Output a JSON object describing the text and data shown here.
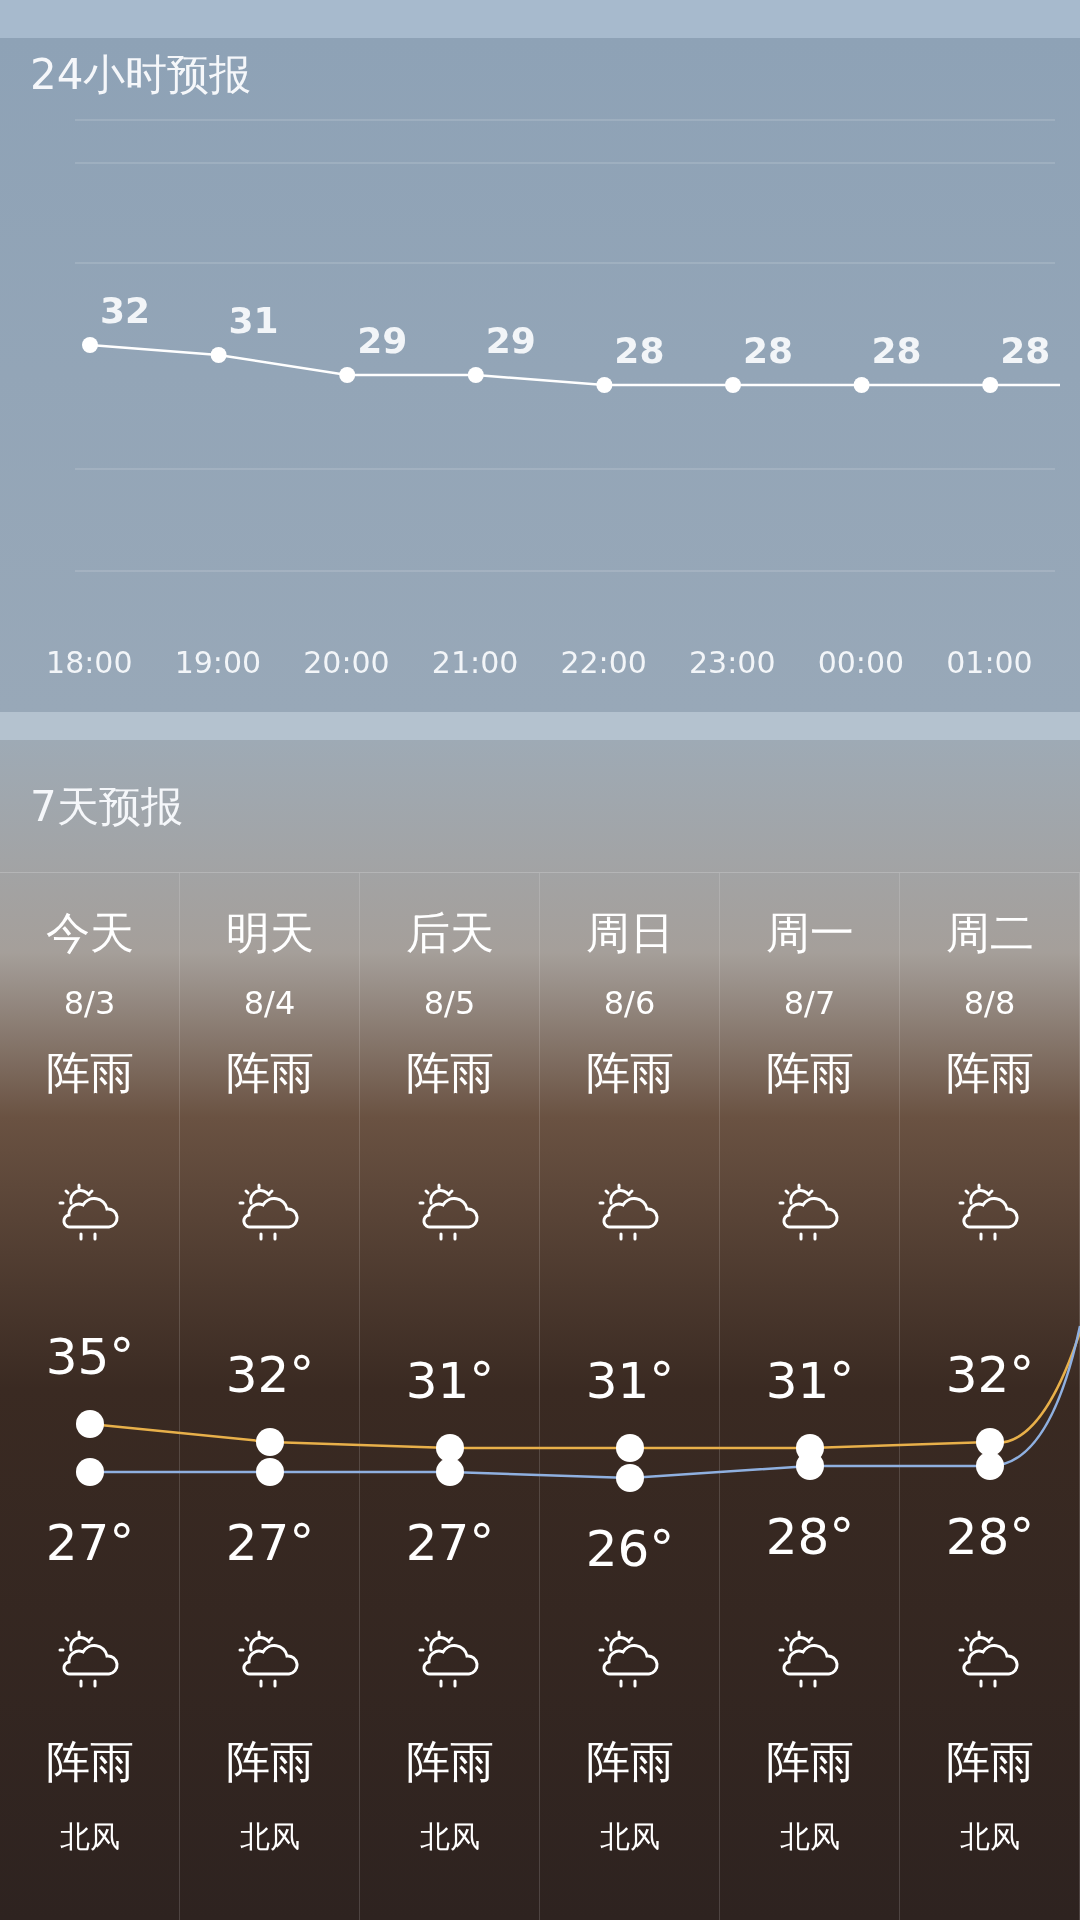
{
  "hourly": {
    "title": "24小时预报",
    "chart_data": {
      "type": "line",
      "categories": [
        "18:00",
        "19:00",
        "20:00",
        "21:00",
        "22:00",
        "23:00",
        "00:00",
        "01:00"
      ],
      "series": [
        {
          "color": "#ffffff",
          "marker": true,
          "values": [
            32,
            31,
            29,
            29,
            28,
            28,
            28,
            28
          ]
        }
      ],
      "data_labels": true
    }
  },
  "daily": {
    "title": "7天预报",
    "days": [
      {
        "day": "今天",
        "weather_day": "阵雨",
        "weather_night": "阵雨",
        "wind": "北风"
      },
      {
        "day": "明天",
        "weather_day": "阵雨",
        "weather_night": "阵雨",
        "wind": "北风"
      },
      {
        "day": "后天",
        "weather_day": "阵雨",
        "weather_night": "阵雨",
        "wind": "北风"
      },
      {
        "day": "周日",
        "weather_day": "阵雨",
        "weather_night": "阵雨",
        "wind": "北风"
      },
      {
        "day": "周一",
        "weather_day": "阵雨",
        "weather_night": "阵雨",
        "wind": "北风"
      },
      {
        "day": "周二",
        "weather_day": "阵雨",
        "weather_night": "阵雨",
        "wind": "北风"
      }
    ],
    "chart_data": {
      "type": "line",
      "categories": [
        "8/3",
        "8/4",
        "8/5",
        "8/6",
        "8/7",
        "8/8"
      ],
      "series": [
        {
          "color": "#e8b04a",
          "marker": true,
          "values": [
            35,
            32,
            31,
            31,
            31,
            32
          ],
          "value_labels": [
            "35°",
            "32°",
            "31°",
            "31°",
            "31°",
            "32°"
          ]
        },
        {
          "color": "#8fb0e0",
          "marker": true,
          "values": [
            27,
            27,
            27,
            26,
            28,
            28
          ],
          "value_labels": [
            "27°",
            "27°",
            "27°",
            "26°",
            "28°",
            "28°"
          ]
        }
      ]
    }
  }
}
